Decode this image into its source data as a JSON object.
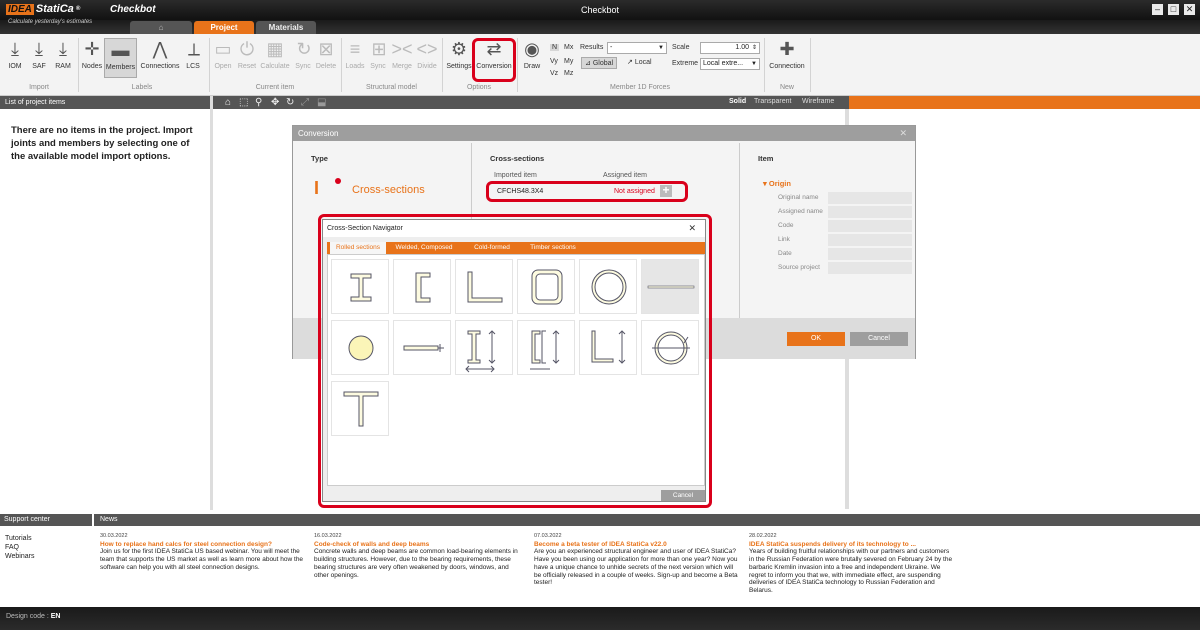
{
  "app": {
    "logo_idea": "IDEA",
    "logo_statica": "StatiCa",
    "logo_reg": "®",
    "name": "Checkbot",
    "tagline": "Calculate yesterday's estimates",
    "window_title": "Checkbot",
    "win_min": "–",
    "win_max": "□",
    "win_close": "✕"
  },
  "tabs": {
    "home": "⌂",
    "project": "Project",
    "materials": "Materials"
  },
  "ribbon": {
    "import": {
      "label": "Import",
      "items": [
        "IOM",
        "SAF",
        "RAM"
      ]
    },
    "labels": {
      "label": "Labels",
      "items": [
        "Nodes",
        "Members",
        "Connections",
        "LCS"
      ]
    },
    "current_item": {
      "label": "Current item",
      "items": [
        "Open",
        "Reset",
        "Calculate",
        "Sync",
        "Delete"
      ]
    },
    "structural_model": {
      "label": "Structural model",
      "items": [
        "Loads",
        "Sync",
        "Merge",
        "Divide"
      ]
    },
    "options": {
      "label": "Options",
      "items": [
        "Settings",
        "Conversion"
      ]
    },
    "member_forces": {
      "label": "Member 1D Forces",
      "draw": "Draw",
      "components": [
        "N",
        "Mx",
        "Vy",
        "My",
        "Vz",
        "Mz"
      ],
      "results_label": "Results",
      "results_value": "-",
      "global": "Global",
      "local": "Local",
      "scale_label": "Scale",
      "scale_value": "1.00",
      "extreme_label": "Extreme",
      "extreme_value": "Local extre..."
    },
    "new": {
      "label": "New",
      "items": [
        "Connection"
      ]
    }
  },
  "project_panel": {
    "header": "List of project items",
    "message": "There are no items in the project. Import joints and members by selecting one of the available model import options."
  },
  "viewport": {
    "modes": [
      "Solid",
      "Transparent",
      "Wireframe"
    ]
  },
  "conversion_dialog": {
    "title": "Conversion",
    "close": "✕",
    "type_head": "Type",
    "type_value": "Cross-sections",
    "cs_head": "Cross-sections",
    "imported_head": "Imported item",
    "assigned_head": "Assigned item",
    "imported_value": "CFCHS48.3X4",
    "assigned_value": "Not assigned",
    "assign_button": "+",
    "item_head": "Item",
    "origin_head": "Origin",
    "properties": [
      "Original name",
      "Assigned name",
      "Code",
      "Link",
      "Date",
      "Source project"
    ],
    "ok": "OK",
    "cancel": "Cancel"
  },
  "navigator": {
    "title": "Cross-Section Navigator",
    "close": "✕",
    "tabs": [
      "Rolled sections",
      "Welded, Composed",
      "Cold-formed",
      "Timber sections"
    ],
    "tiles": [
      "i-section",
      "channel",
      "angle",
      "rect-hollow",
      "circ-hollow",
      "flat",
      "round-bar",
      "flat-bar",
      "i-pair",
      "channel-pair",
      "angle-pair",
      "circ-pair",
      "t-section"
    ],
    "cancel": "Cancel"
  },
  "support": {
    "header": "Support center",
    "items": [
      "Tutorials",
      "FAQ",
      "Webinars"
    ]
  },
  "news": {
    "header": "News",
    "items": [
      {
        "date": "30.03.2022",
        "title": "How to replace hand calcs for steel connection design?",
        "body": "Join us for the first IDEA StatiCa US based webinar. You will meet the team that supports the US market as well as learn more about how the software can help you with all steel connection designs."
      },
      {
        "date": "16.03.2022",
        "title": "Code-check of walls and deep beams",
        "body": "Concrete walls and deep beams are common load-bearing elements in building structures. However, due to the bearing requirements, these bearing structures are very often weakened by doors, windows, and other openings."
      },
      {
        "date": "07.03.2022",
        "title": "Become a beta tester of IDEA StatiCa v22.0",
        "body": "Are you an experienced structural engineer and user of IDEA StatiCa? Have you been using our application for more than one year? Now you have a unique chance to unhide secrets of the next version which will be officially released in a couple of weeks. Sign-up and become a Beta tester!"
      },
      {
        "date": "28.02.2022",
        "title": "IDEA StatiCa suspends delivery of its technology to ...",
        "body": "Years of building fruitful relationships with our partners and customers in the Russian Federation were brutally severed on February 24 by the barbaric Kremlin invasion into a free and independent Ukraine. We regret to inform you that we, with immediate effect, are suspending deliveries of IDEA StatiCa technology to Russian Federation and Belarus."
      }
    ]
  },
  "status": {
    "design_code_label": "Design code :",
    "design_code_value": "EN"
  },
  "colors": {
    "accent": "#e8731a",
    "highlight": "#d9001b",
    "dark": "#1a1a1a"
  }
}
